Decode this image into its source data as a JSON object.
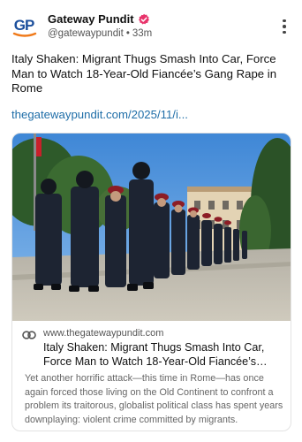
{
  "post": {
    "author": {
      "display_name": "Gateway Pundit",
      "handle": "@gatewaypundit",
      "time": "33m",
      "avatar_text": "GP"
    },
    "text": "Italy Shaken: Migrant Thugs Smash Into Car, Force Man to Watch 18-Year-Old Fiancée’s Gang Rape in Rome",
    "link_text": "thegatewaypundit.com/2025/11/i...",
    "card": {
      "domain": "www.thegatewaypundit.com",
      "title": "Italy Shaken: Migrant Thugs Smash Into Car, Force Man to Watch 18-Year-Old Fiancée’s Gang Rape in Rome",
      "description": "Yet another horrific attack—this time in Rome—has once again forced those living on the Old Continent to confront a problem its traitorous, globalist political class has spent years downplaying: violent crime committed by migrants."
    }
  },
  "colors": {
    "link": "#1f6ea8",
    "verified_badge": "#e8336b",
    "avatar_blue": "#1b4f9c",
    "avatar_orange": "#f07a1a"
  },
  "icons": {
    "verified": "verified-badge-icon",
    "more": "vertical-dots-icon",
    "link": "chain-link-icon"
  }
}
